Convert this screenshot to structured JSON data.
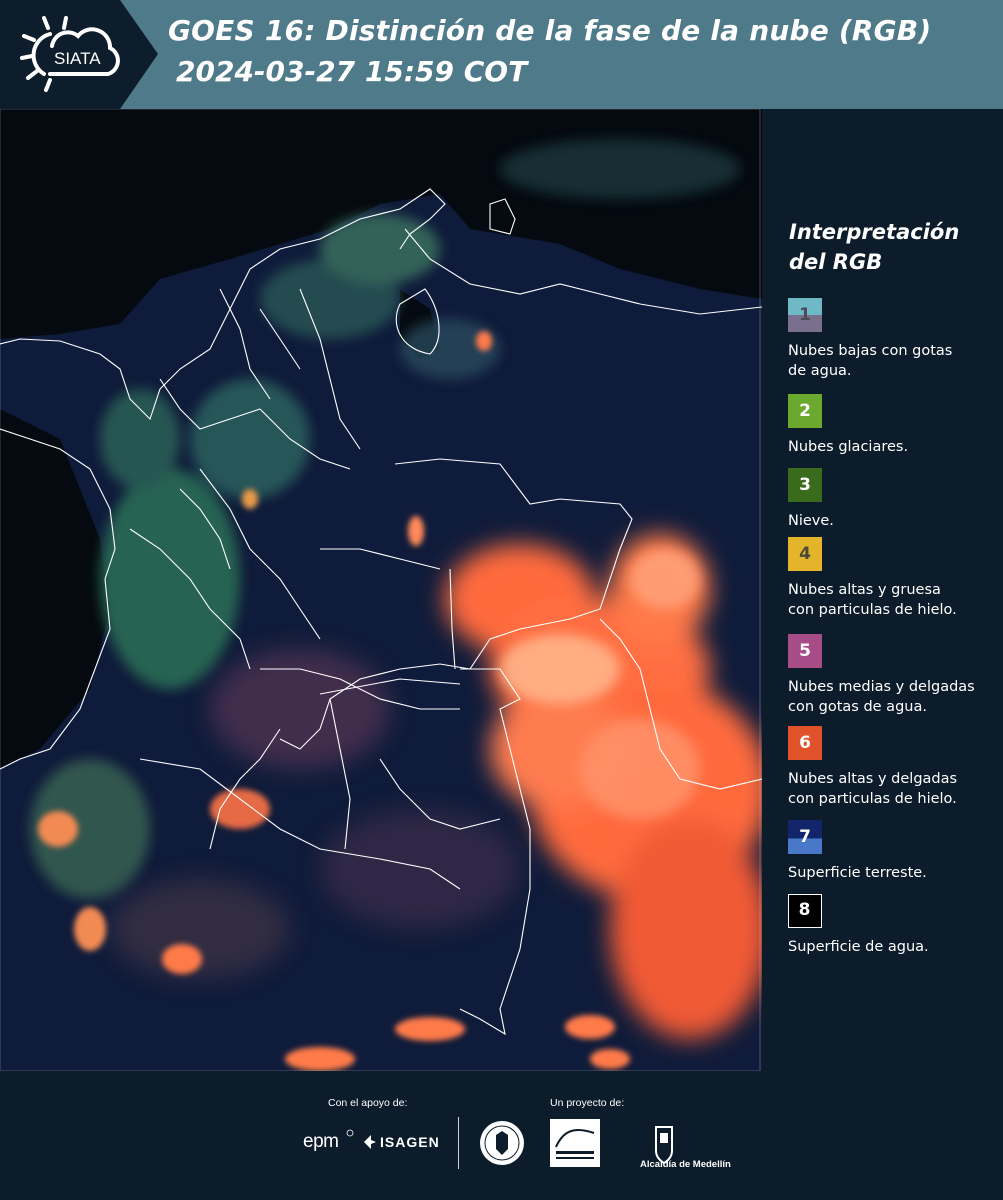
{
  "header": {
    "title": "GOES 16: Distinción de la fase de la nube (RGB)",
    "datetime": "2024-03-27 15:59 COT",
    "logo_text": "SIATA"
  },
  "map": {
    "description_colors": {
      "ocean": "#050a10",
      "land": "#0f1b3a",
      "ice_clouds": "#ff6a3d",
      "green_clouds": "#3c8a5a",
      "borders": "#ffffff"
    }
  },
  "legend": {
    "title_line1": "Interpretación",
    "title_line2": "del RGB",
    "items": [
      {
        "number": "1",
        "label_line1": "Nubes bajas con gotas",
        "label_line2": "de agua.",
        "color_top": "#6fb8c6",
        "color_bottom": "#7a6f8c",
        "num_color": "#4a4a5a"
      },
      {
        "number": "2",
        "label_line1": "Nubes glaciares.",
        "label_line2": "",
        "color_top": "#6aa82e",
        "color_bottom": "#6aa82e",
        "num_color": "#ffffff"
      },
      {
        "number": "3",
        "label_line1": "Nieve.",
        "label_line2": "",
        "color_top": "#3a6a1c",
        "color_bottom": "#3a6a1c",
        "num_color": "#ffffff"
      },
      {
        "number": "4",
        "label_line1": "Nubes altas y gruesa",
        "label_line2": "con particulas de hielo.",
        "color_top": "#e4b52a",
        "color_bottom": "#e4b52a",
        "num_color": "#4a4a3a"
      },
      {
        "number": "5",
        "label_line1": "Nubes medias y delgadas",
        "label_line2": "con gotas de agua.",
        "color_top": "#a64d88",
        "color_bottom": "#a64d88",
        "num_color": "#ffffff"
      },
      {
        "number": "6",
        "label_line1": "Nubes altas y delgadas",
        "label_line2": "con particulas de hielo.",
        "color_top": "#e2522a",
        "color_bottom": "#e2522a",
        "num_color": "#ffffff"
      },
      {
        "number": "7",
        "label_line1": "Superficie terreste.",
        "label_line2": "",
        "color_top": "#12246a",
        "color_bottom": "#4a78c8",
        "num_color": "#ffffff"
      },
      {
        "number": "8",
        "label_line1": "Superficie de agua.",
        "label_line2": "",
        "color_top": "#000000",
        "color_bottom": "#000000",
        "num_color": "#ffffff"
      }
    ]
  },
  "footer": {
    "support_label": "Con el apoyo de:",
    "project_label": "Un proyecto de:",
    "epm": "epm",
    "isagen": "ISAGEN",
    "alcaldia": "Alcaldía de Medellín"
  }
}
